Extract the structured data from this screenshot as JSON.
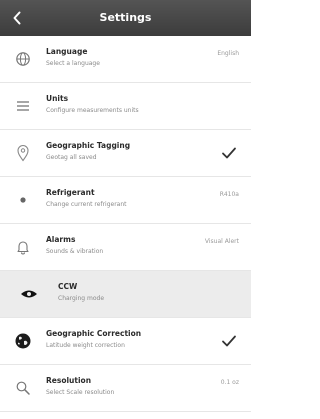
{
  "header": {
    "title": "Settings"
  },
  "rows": [
    {
      "label": "Language",
      "subtitle": "Select a language",
      "value": "English",
      "icon": "globe-icon"
    },
    {
      "label": "Units",
      "subtitle": "Configure measurements units",
      "value": "",
      "icon": "list-icon"
    },
    {
      "label": "Geographic Tagging",
      "subtitle": "Geotag all saved",
      "value": "",
      "icon": "location-pin-icon",
      "checked": true
    },
    {
      "label": "Refrigerant",
      "subtitle": "Change current refrigerant",
      "value": "R410a",
      "icon": "dot-icon"
    },
    {
      "label": "Alarms",
      "subtitle": "Sounds & vibration",
      "value": "Visual Alert",
      "icon": "bell-icon"
    },
    {
      "label": "CCW",
      "subtitle": "Charging mode",
      "value": "",
      "icon": "eye-icon"
    },
    {
      "label": "Geographic Correction",
      "subtitle": "Latitude weight correction",
      "value": "",
      "icon": "globe-dark-icon",
      "checked": true
    },
    {
      "label": "Resolution",
      "subtitle": "Select Scale resolution",
      "value": "0.1 oz",
      "icon": "magnifier-icon"
    }
  ]
}
